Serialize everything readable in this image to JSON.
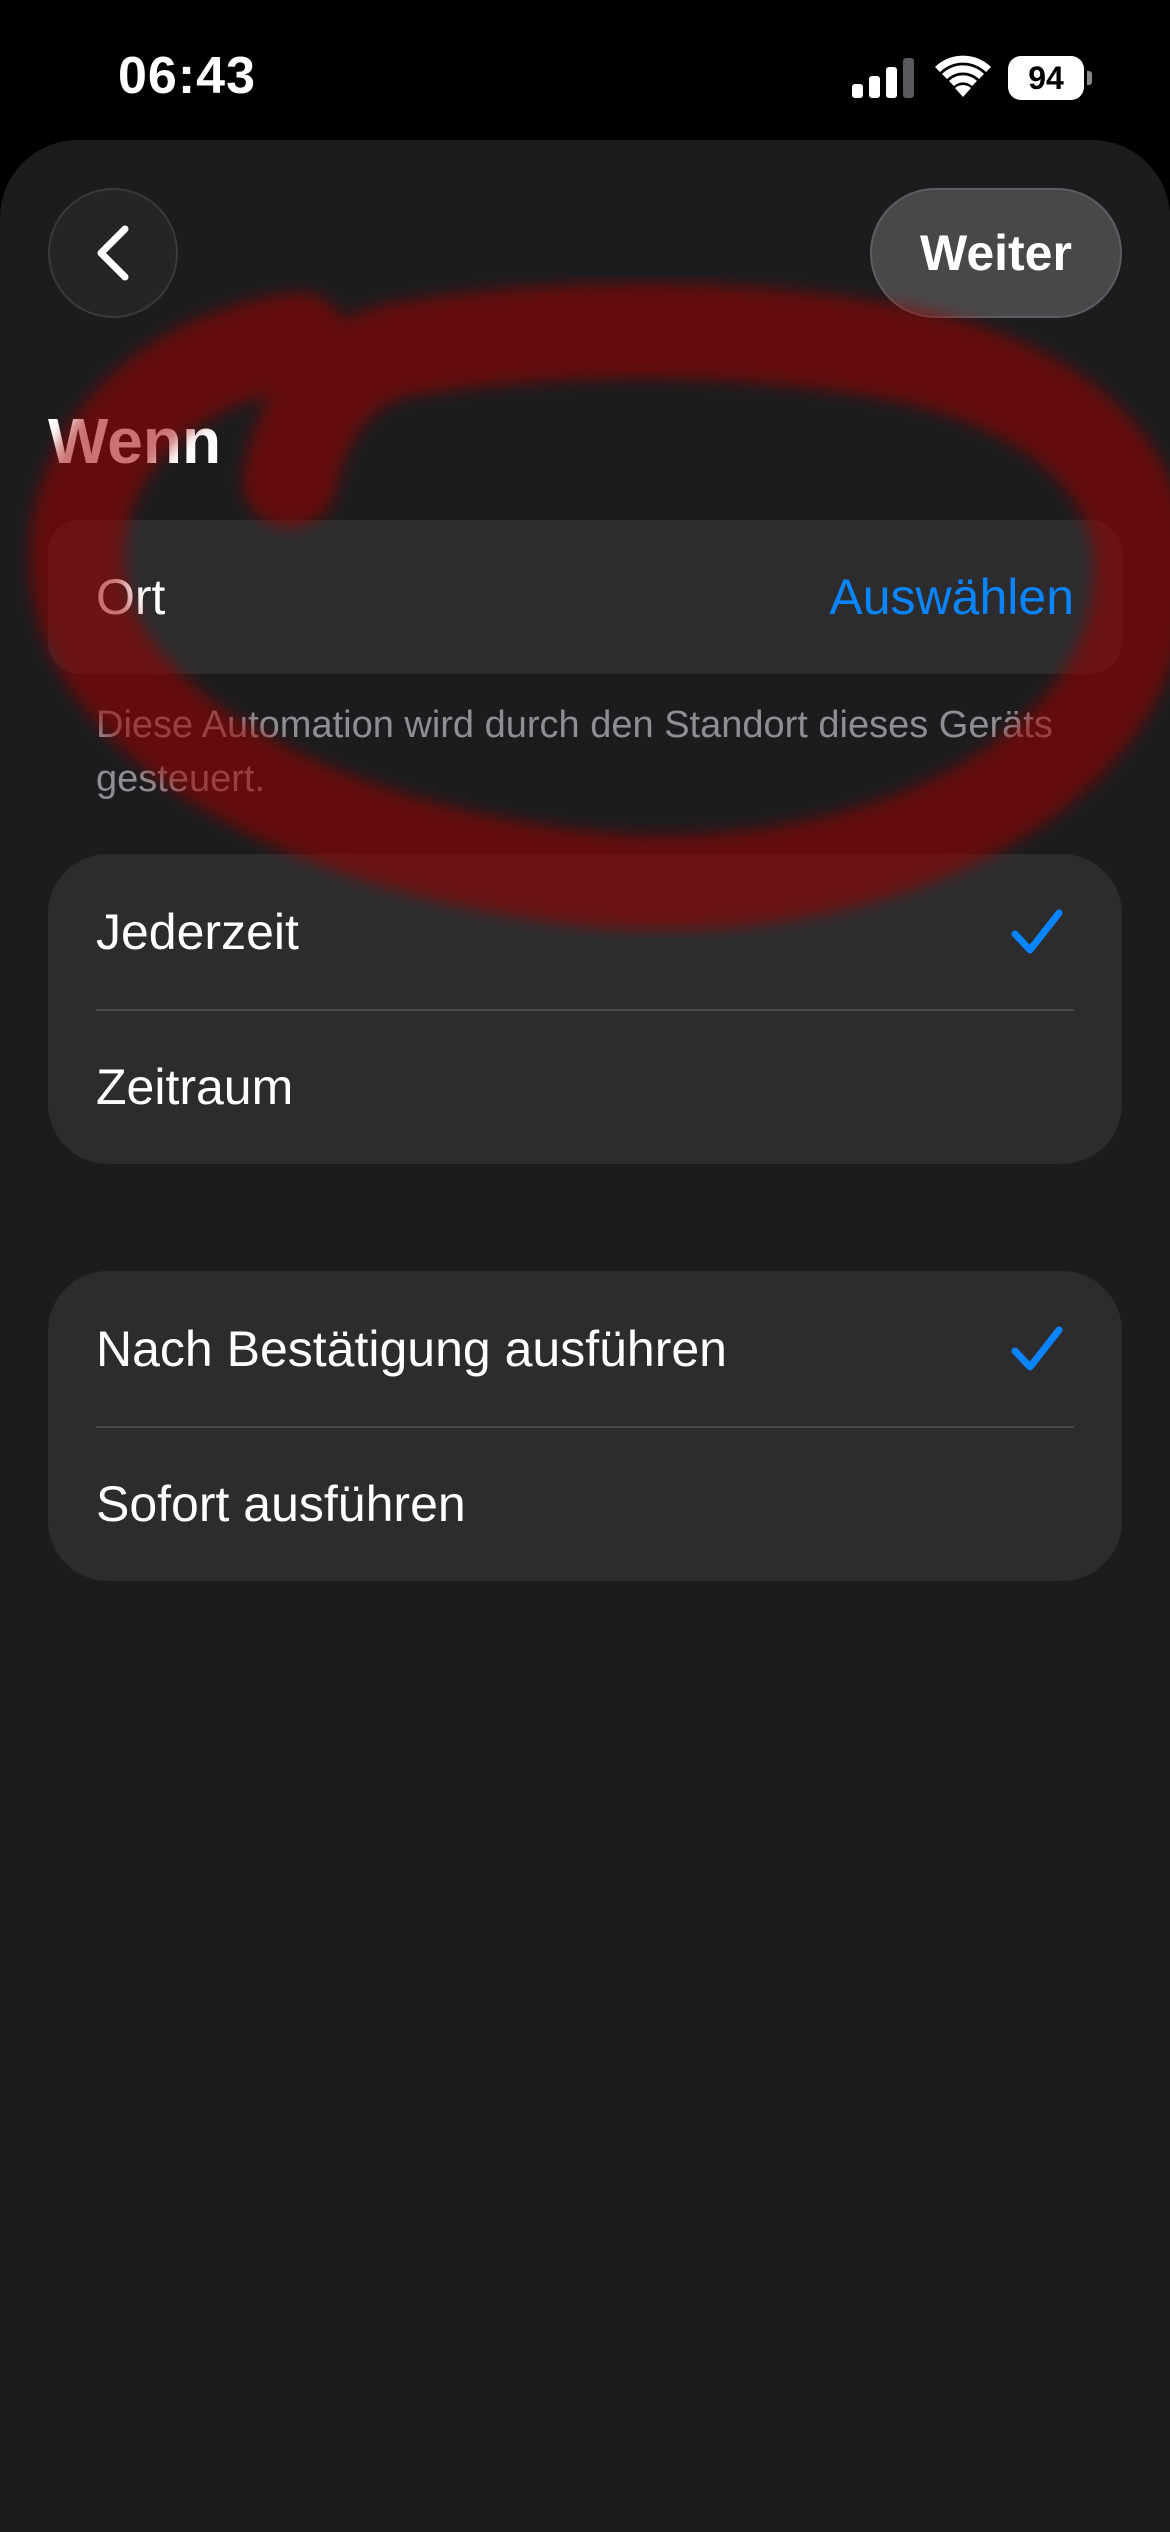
{
  "status_bar": {
    "time": "06:43",
    "battery_level": "94",
    "battery_percent": 94,
    "icons": [
      "signal-icon",
      "wifi-icon",
      "battery-icon"
    ]
  },
  "header": {
    "back_icon": "chevron-left-icon",
    "next_label": "Weiter"
  },
  "when_section": {
    "title": "Wenn",
    "location_label": "Ort",
    "location_action": "Auswählen",
    "footnote": "Diese Automation wird durch den Standort dieses Geräts gesteuert."
  },
  "time_group": {
    "items": [
      {
        "label": "Jederzeit",
        "selected": true
      },
      {
        "label": "Zeitraum",
        "selected": false
      }
    ]
  },
  "run_group": {
    "items": [
      {
        "label": "Nach Bestätigung ausführen",
        "selected": true
      },
      {
        "label": "Sofort ausführen",
        "selected": false
      }
    ]
  },
  "colors": {
    "background": "#000000",
    "sheet": "#1c1c1e",
    "cell": "#2c2c2e",
    "accent": "#0a84ff",
    "secondary_text": "#8e8e93",
    "annotation": "#a80000"
  }
}
